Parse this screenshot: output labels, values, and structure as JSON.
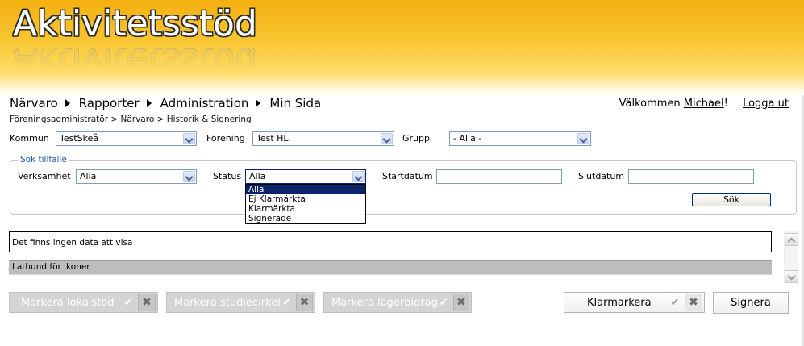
{
  "header": {
    "logo_text": "Aktivitetsstöd"
  },
  "nav": {
    "items": [
      {
        "label": "Närvaro"
      },
      {
        "label": "Rapporter"
      },
      {
        "label": "Administration"
      },
      {
        "label": "Min Sida"
      }
    ]
  },
  "user": {
    "welcome_prefix": "Välkommen",
    "name": "Michael",
    "welcome_suffix": "!",
    "logout": "Logga ut"
  },
  "breadcrumb": "Föreningsadministratör > Närvaro > Historik & Signering",
  "filters": {
    "kommun": {
      "label": "Kommun",
      "value": "TestSkeå"
    },
    "forening": {
      "label": "Förening",
      "value": "Test HL"
    },
    "grupp": {
      "label": "Grupp",
      "value": "- Alla -"
    }
  },
  "search": {
    "legend": "Sök tillfälle",
    "verksamhet": {
      "label": "Verksamhet",
      "value": "Alla"
    },
    "status": {
      "label": "Status",
      "value": "Alla",
      "options": [
        "Alla",
        "Ej Klarmärkta",
        "Klarmärkta",
        "Signerade"
      ]
    },
    "startdatum": {
      "label": "Startdatum",
      "value": ""
    },
    "slutdatum": {
      "label": "Slutdatum",
      "value": ""
    },
    "button": "Sök"
  },
  "results": {
    "empty_message": "Det finns ingen data att visa",
    "legend_bar": "Lathund för ikoner"
  },
  "actions": {
    "markera_lokalstod": "Markera lokalstöd",
    "markera_studiecirkel": "Markera studiecirkel",
    "markera_lagerbidrag": "Markera lägerbidrag",
    "klarmarkera": "Klarmarkera",
    "signera": "Signera",
    "check_glyph": "✔",
    "x_glyph": "✖"
  },
  "colors": {
    "header_top": "#f3b011",
    "header_bottom": "#fff3c4",
    "legend_text": "#1a5aa6",
    "dropdown_selected": "#0a246a",
    "disabled_button": "#d4d4d4"
  }
}
